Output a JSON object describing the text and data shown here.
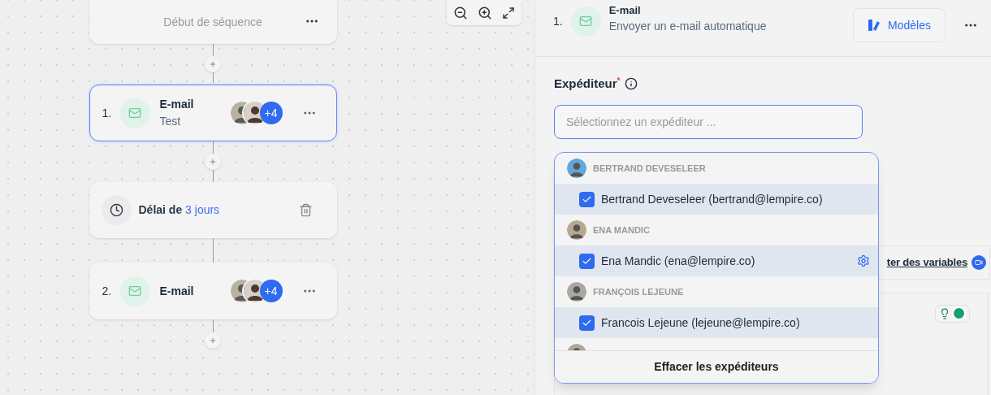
{
  "canvas": {
    "nodes": [
      {
        "kind": "start",
        "label": "Début de séquence"
      },
      {
        "kind": "email",
        "number": "1.",
        "title": "E-mail",
        "subtitle": "Test",
        "extra_count": "+4",
        "selected": true
      },
      {
        "kind": "delay",
        "label": "Délai de",
        "value": "3 jours"
      },
      {
        "kind": "email",
        "number": "2.",
        "title": "E-mail",
        "extra_count": "+4",
        "selected": false
      }
    ]
  },
  "panel": {
    "step": {
      "number": "1.",
      "title": "E-mail",
      "subtitle": "Envoyer un e-mail automatique"
    },
    "templates_button": "Modèles",
    "sender": {
      "label": "Expéditeur",
      "required_mark": "*",
      "placeholder": "Sélectionnez un expéditeur ..."
    },
    "dropdown": {
      "groups": [
        {
          "name": "BERTRAND DEVESELEER",
          "options": [
            {
              "label": "Bertrand Deveseleer (bertrand@lempire.co)",
              "checked": true,
              "hovered": false
            }
          ]
        },
        {
          "name": "ENA MANDIC",
          "options": [
            {
              "label": "Ena Mandic (ena@lempire.co)",
              "checked": true,
              "hovered": true
            }
          ]
        },
        {
          "name": "FRANÇOIS LEJEUNE",
          "options": [
            {
              "label": "Francois Lejeune (lejeune@lempire.co)",
              "checked": true,
              "hovered": false
            }
          ]
        }
      ],
      "clear_button": "Effacer les expéditeurs"
    },
    "variables_link": "ter des variables"
  }
}
